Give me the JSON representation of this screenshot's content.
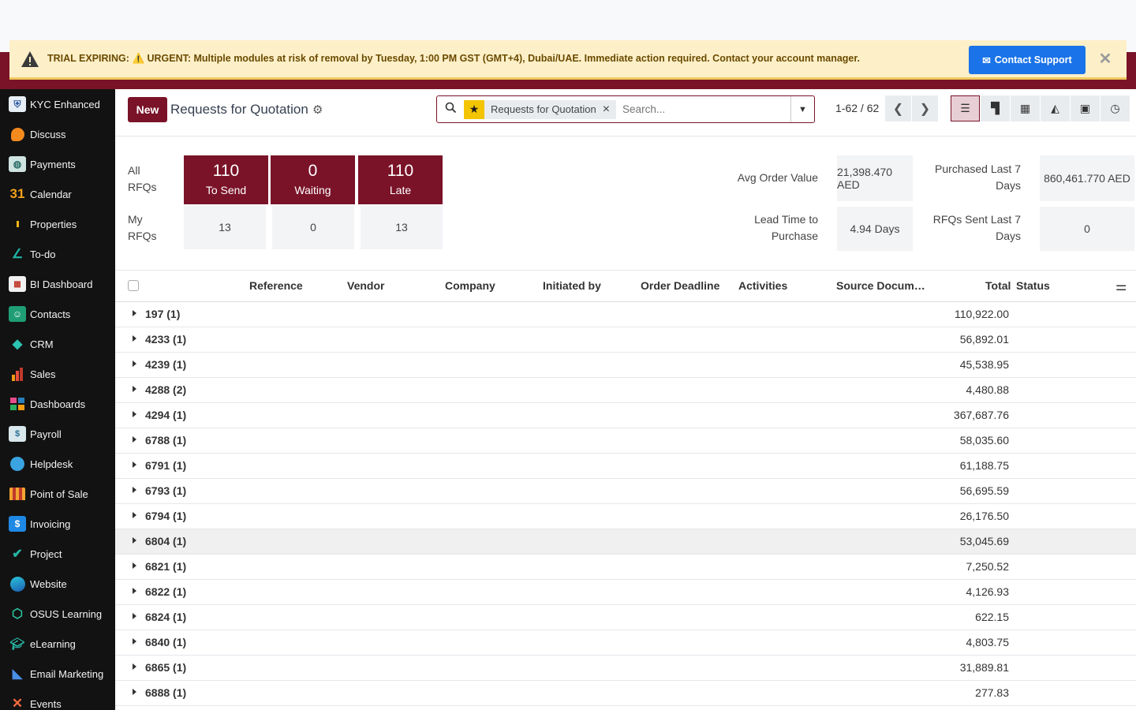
{
  "colors": {
    "brand": "#7a1328",
    "banner_bg": "#fdf0c8",
    "sidebar_bg": "#121212",
    "support_btn": "#1a73e8",
    "favorite_star": "#f3c400"
  },
  "banner": {
    "label": "TRIAL EXPIRING:",
    "message": "⚠️ URGENT: Multiple modules at risk of removal by Tuesday, 1:00 PM GST (GMT+4), Dubai/UAE. Immediate action required. Contact your account manager.",
    "support_button": "Contact Support"
  },
  "sidebar": {
    "items": [
      {
        "label": "KYC Enhanced",
        "icon": "shield-icon"
      },
      {
        "label": "Discuss",
        "icon": "chat-bubble-icon"
      },
      {
        "label": "Payments",
        "icon": "payments-icon"
      },
      {
        "label": "Calendar",
        "icon": "calendar-31-icon"
      },
      {
        "label": "Properties",
        "icon": "properties-icon"
      },
      {
        "label": "To-do",
        "icon": "checkmark-pen-icon"
      },
      {
        "label": "BI Dashboard",
        "icon": "bi-dashboard-icon"
      },
      {
        "label": "Contacts",
        "icon": "contacts-icon"
      },
      {
        "label": "CRM",
        "icon": "crm-diamond-icon"
      },
      {
        "label": "Sales",
        "icon": "sales-chart-icon"
      },
      {
        "label": "Dashboards",
        "icon": "dashboards-icon"
      },
      {
        "label": "Payroll",
        "icon": "payroll-icon"
      },
      {
        "label": "Helpdesk",
        "icon": "helpdesk-icon"
      },
      {
        "label": "Point of Sale",
        "icon": "store-awning-icon"
      },
      {
        "label": "Invoicing",
        "icon": "invoice-dollar-icon"
      },
      {
        "label": "Project",
        "icon": "project-check-icon"
      },
      {
        "label": "Website",
        "icon": "globe-icon"
      },
      {
        "label": "OSUS Learning",
        "icon": "cube-icon"
      },
      {
        "label": "eLearning",
        "icon": "graduation-cap-icon"
      },
      {
        "label": "Email Marketing",
        "icon": "paper-plane-icon"
      },
      {
        "label": "Events",
        "icon": "events-icon"
      }
    ]
  },
  "control_panel": {
    "new_button": "New",
    "title": "Requests for Quotation",
    "search": {
      "facet": "Requests for Quotation",
      "placeholder": "Search..."
    },
    "pager": "1-62 / 62"
  },
  "dashboard": {
    "all_label": "All RFQs",
    "my_label": "My RFQs",
    "tiles": [
      {
        "value": "110",
        "caption": "To Send",
        "mine": "13"
      },
      {
        "value": "0",
        "caption": "Waiting",
        "mine": "0"
      },
      {
        "value": "110",
        "caption": "Late",
        "mine": "13"
      }
    ],
    "kpis": [
      {
        "label": "Avg Order Value",
        "value": "21,398.470 AED"
      },
      {
        "label": "Purchased Last 7 Days",
        "value": "860,461.770 AED"
      },
      {
        "label": "Lead Time to Purchase",
        "value": "4.94 Days"
      },
      {
        "label": "RFQs Sent Last 7 Days",
        "value": "0"
      }
    ]
  },
  "list": {
    "columns": [
      "Reference",
      "Vendor",
      "Company",
      "Initiated by",
      "Order Deadline",
      "Activities",
      "Source Docum…",
      "Total",
      "Status"
    ],
    "rows": [
      {
        "group": "197 (1)",
        "total": "110,922.00"
      },
      {
        "group": "4233 (1)",
        "total": "56,892.01"
      },
      {
        "group": "4239 (1)",
        "total": "45,538.95"
      },
      {
        "group": "4288 (2)",
        "total": "4,480.88"
      },
      {
        "group": "4294 (1)",
        "total": "367,687.76"
      },
      {
        "group": "6788 (1)",
        "total": "58,035.60"
      },
      {
        "group": "6791 (1)",
        "total": "61,188.75"
      },
      {
        "group": "6793 (1)",
        "total": "56,695.59"
      },
      {
        "group": "6794 (1)",
        "total": "26,176.50"
      },
      {
        "group": "6804 (1)",
        "total": "53,045.69"
      },
      {
        "group": "6821 (1)",
        "total": "7,250.52"
      },
      {
        "group": "6822 (1)",
        "total": "4,126.93"
      },
      {
        "group": "6824 (1)",
        "total": "622.15"
      },
      {
        "group": "6840 (1)",
        "total": "4,803.75"
      },
      {
        "group": "6865 (1)",
        "total": "31,889.81"
      },
      {
        "group": "6888 (1)",
        "total": "277.83"
      }
    ]
  }
}
